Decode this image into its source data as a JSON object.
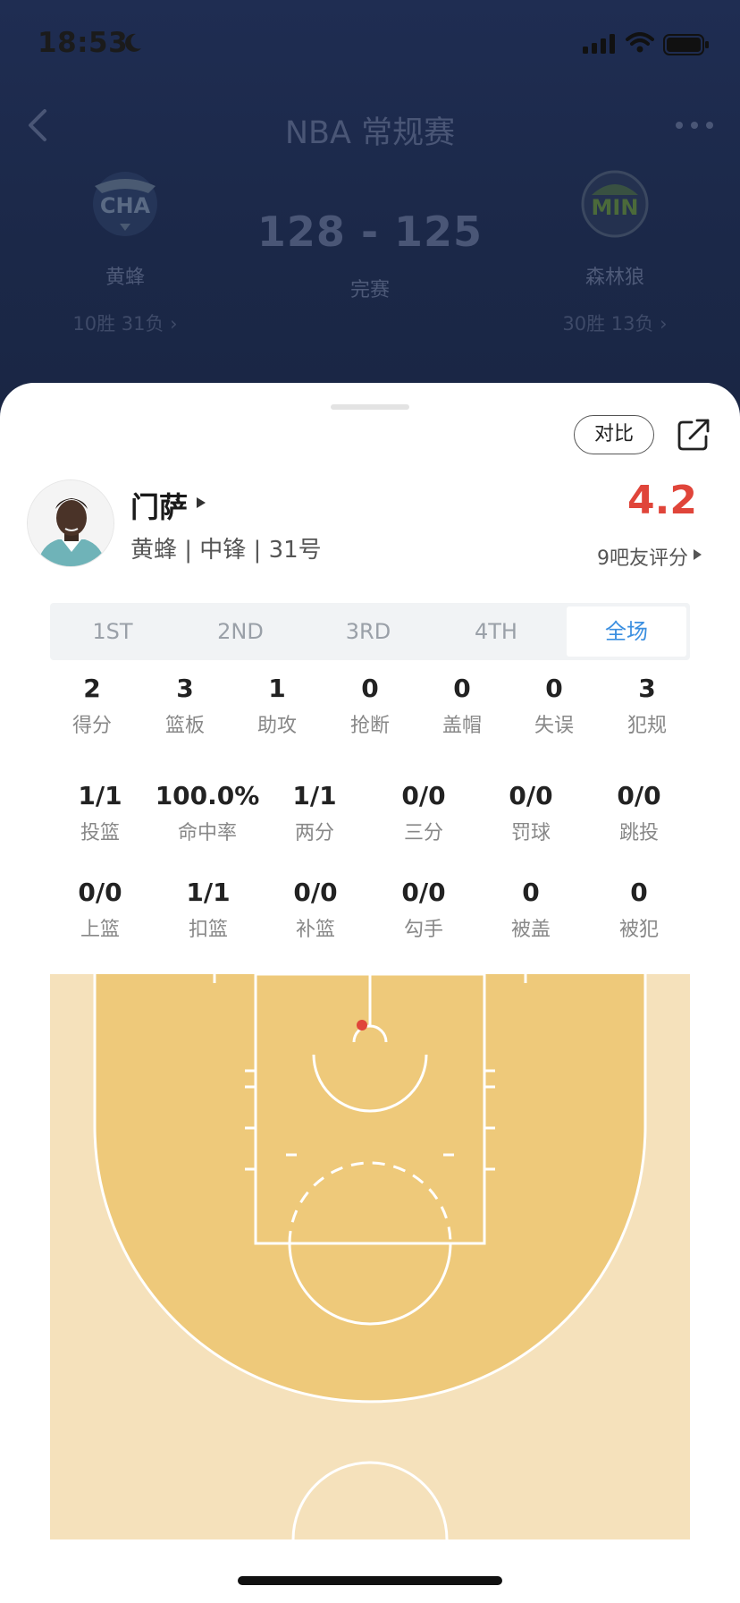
{
  "status_bar": {
    "time": "18:53"
  },
  "nav": {
    "title": "NBA 常规赛"
  },
  "match": {
    "home": {
      "abbr": "CHA",
      "name": "黄蜂",
      "record": "10胜 31负 ›"
    },
    "away": {
      "abbr": "MIN",
      "name": "森林狼",
      "record": "30胜 13负 ›"
    },
    "score": "128 - 125",
    "status": "完赛"
  },
  "sheet": {
    "compare_label": "对比",
    "player": {
      "name": "门萨",
      "info": "黄蜂 | 中锋 | 31号"
    },
    "rating": {
      "value": "4.2",
      "label": "9吧友评分"
    },
    "tabs": [
      "1ST",
      "2ND",
      "3RD",
      "4TH",
      "全场"
    ],
    "active_tab": "全场",
    "stats_row1": [
      {
        "value": "2",
        "label": "得分"
      },
      {
        "value": "3",
        "label": "篮板"
      },
      {
        "value": "1",
        "label": "助攻"
      },
      {
        "value": "0",
        "label": "抢断"
      },
      {
        "value": "0",
        "label": "盖帽"
      },
      {
        "value": "0",
        "label": "失误"
      },
      {
        "value": "3",
        "label": "犯规"
      }
    ],
    "stats_row2": [
      {
        "value": "1/1",
        "label": "投篮"
      },
      {
        "value": "100.0%",
        "label": "命中率"
      },
      {
        "value": "1/1",
        "label": "两分"
      },
      {
        "value": "0/0",
        "label": "三分"
      },
      {
        "value": "0/0",
        "label": "罚球"
      },
      {
        "value": "0/0",
        "label": "跳投"
      }
    ],
    "stats_row3": [
      {
        "value": "0/0",
        "label": "上篮"
      },
      {
        "value": "1/1",
        "label": "扣篮"
      },
      {
        "value": "0/0",
        "label": "补篮"
      },
      {
        "value": "0/0",
        "label": "勾手"
      },
      {
        "value": "0",
        "label": "被盖"
      },
      {
        "value": "0",
        "label": "被犯"
      }
    ]
  },
  "colors": {
    "court_paint": "#eec97a",
    "court_outer": "#f5e1bb",
    "shot_made": "#e0453a",
    "accent": "#3b8fe0"
  }
}
